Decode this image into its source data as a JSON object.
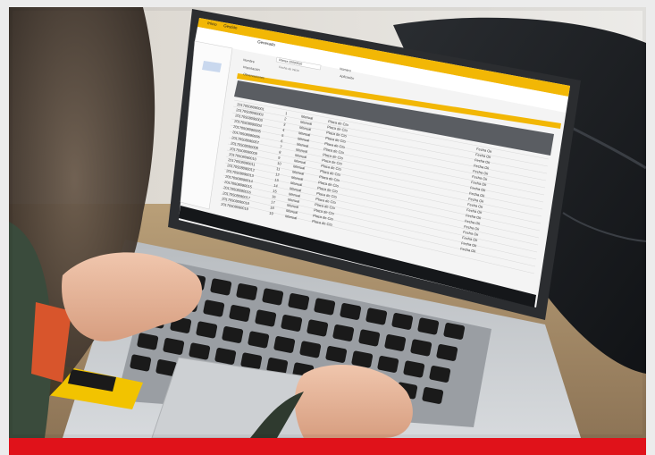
{
  "photo": {
    "screen_app": {
      "toolbar": {
        "tab_1": "Inicio",
        "tab_2": "Gestión"
      },
      "toolbar_section": "Generado",
      "form": {
        "label_1": "Nombre",
        "label_2": "Importación",
        "label_3": "Observaciones",
        "label_4": "Número",
        "label_5": "Aplicación",
        "field_1": "Planes 20000520",
        "field_2": "Fecha de inicio"
      },
      "table": {
        "rows": [
          {
            "id": "20170508090001",
            "n": "1",
            "mode": "Manual",
            "desc": "Placa de Cto"
          },
          {
            "id": "20170508090002",
            "n": "2",
            "mode": "Manual",
            "desc": "Placa de Cto"
          },
          {
            "id": "20170508090003",
            "n": "3",
            "mode": "Manual",
            "desc": "Placa de Cto"
          },
          {
            "id": "20170508090004",
            "n": "4",
            "mode": "Manual",
            "desc": "Placa de Cto"
          },
          {
            "id": "20170508090005",
            "n": "5",
            "mode": "Manual",
            "desc": "Placa de Cto"
          },
          {
            "id": "20170508090006",
            "n": "6",
            "mode": "Manual",
            "desc": "Placa de Cto"
          },
          {
            "id": "20170508090007",
            "n": "7",
            "mode": "Manual",
            "desc": "Placa de Cto"
          },
          {
            "id": "20170508090008",
            "n": "8",
            "mode": "Manual",
            "desc": "Placa de Cto"
          },
          {
            "id": "20170508090009",
            "n": "9",
            "mode": "Manual",
            "desc": "Placa de Cto"
          },
          {
            "id": "20170508090010",
            "n": "10",
            "mode": "Manual",
            "desc": "Placa de Cto"
          },
          {
            "id": "20170508090011",
            "n": "11",
            "mode": "Manual",
            "desc": "Placa de Cto"
          },
          {
            "id": "20170508090012",
            "n": "12",
            "mode": "Manual",
            "desc": "Placa de Cto"
          },
          {
            "id": "20170508090013",
            "n": "13",
            "mode": "Manual",
            "desc": "Placa de Cto"
          },
          {
            "id": "20170508090014",
            "n": "14",
            "mode": "Manual",
            "desc": "Placa de Cto"
          },
          {
            "id": "20170508090015",
            "n": "15",
            "mode": "Manual",
            "desc": "Placa de Cto"
          },
          {
            "id": "20170508090016",
            "n": "16",
            "mode": "Manual",
            "desc": "Placa de Cto"
          },
          {
            "id": "20170508090017",
            "n": "17",
            "mode": "Manual",
            "desc": "Placa de Cto"
          },
          {
            "id": "20170508090018",
            "n": "18",
            "mode": "Manual",
            "desc": "Placa de Cto"
          },
          {
            "id": "20170508090019",
            "n": "19",
            "mode": "Manual",
            "desc": "Placa de Cto"
          }
        ],
        "status": "Fecha Ok"
      }
    },
    "colors": {
      "brand_yellow": "#f2b705",
      "brand_red": "#e0121a",
      "keycap": "#1a1a1a"
    }
  }
}
